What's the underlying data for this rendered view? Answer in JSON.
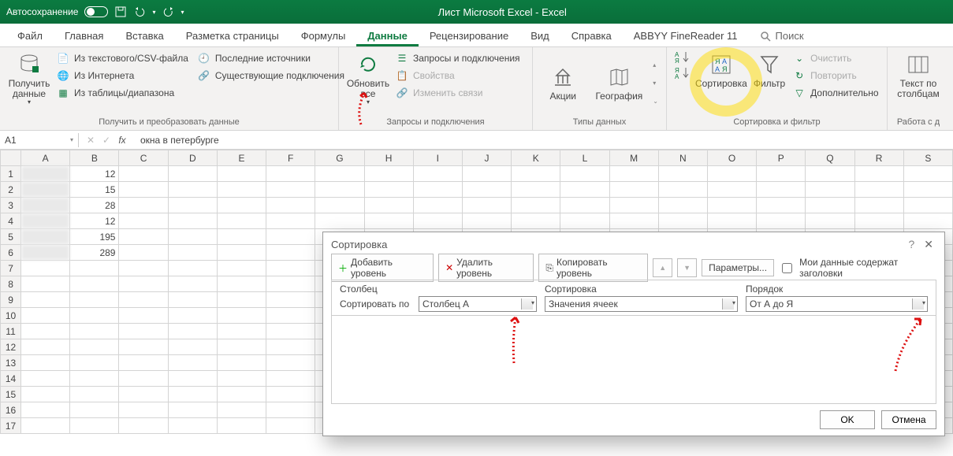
{
  "titlebar": {
    "autosave": "Автосохранение",
    "title": "Лист Microsoft Excel  -  Excel"
  },
  "tabs": {
    "file": "Файл",
    "home": "Главная",
    "insert": "Вставка",
    "layout": "Разметка страницы",
    "formulas": "Формулы",
    "data": "Данные",
    "review": "Рецензирование",
    "view": "Вид",
    "help": "Справка",
    "abbyy": "ABBYY FineReader 11",
    "search": "Поиск"
  },
  "ribbon": {
    "get_data": "Получить данные",
    "from_csv": "Из текстового/CSV-файла",
    "from_web": "Из Интернета",
    "from_table": "Из таблицы/диапазона",
    "recent": "Последние источники",
    "existing": "Существующие подключения",
    "group1_title": "Получить и преобразовать данные",
    "refresh": "Обновить все",
    "queries": "Запросы и подключения",
    "props": "Свойства",
    "edit_links": "Изменить связи",
    "group2_title": "Запросы и подключения",
    "stocks": "Акции",
    "geo": "География",
    "group3_title": "Типы данных",
    "sort": "Сортировка",
    "filter": "Фильтр",
    "clear": "Очистить",
    "reapply": "Повторить",
    "advanced": "Дополнительно",
    "group4_title": "Сортировка и фильтр",
    "text_cols": "Текст по столбцам",
    "group5_title": "Работа с д"
  },
  "formula": {
    "cell": "A1",
    "value": "окна в петербурге"
  },
  "grid": {
    "cols": [
      "A",
      "B",
      "C",
      "D",
      "E",
      "F",
      "G",
      "H",
      "I",
      "J",
      "K",
      "L",
      "M",
      "N",
      "O",
      "P",
      "Q",
      "R",
      "S"
    ],
    "rows": [
      1,
      2,
      3,
      4,
      5,
      6,
      7,
      8,
      9,
      10,
      11,
      12,
      13,
      14,
      15,
      16,
      17
    ],
    "bvals": {
      "1": "12",
      "2": "15",
      "3": "28",
      "4": "12",
      "5": "195",
      "6": "289"
    }
  },
  "dialog": {
    "title": "Сортировка",
    "add": "Добавить уровень",
    "del": "Удалить уровень",
    "copy": "Копировать уровень",
    "params": "Параметры...",
    "header_check": "Мои данные содержат заголовки",
    "col_h": "Столбец",
    "sort_h": "Сортировка",
    "order_h": "Порядок",
    "sort_by": "Сортировать по",
    "col_val": "Столбец A",
    "sort_val": "Значения ячеек",
    "order_val": "От А до Я",
    "ok": "OK",
    "cancel": "Отмена"
  }
}
